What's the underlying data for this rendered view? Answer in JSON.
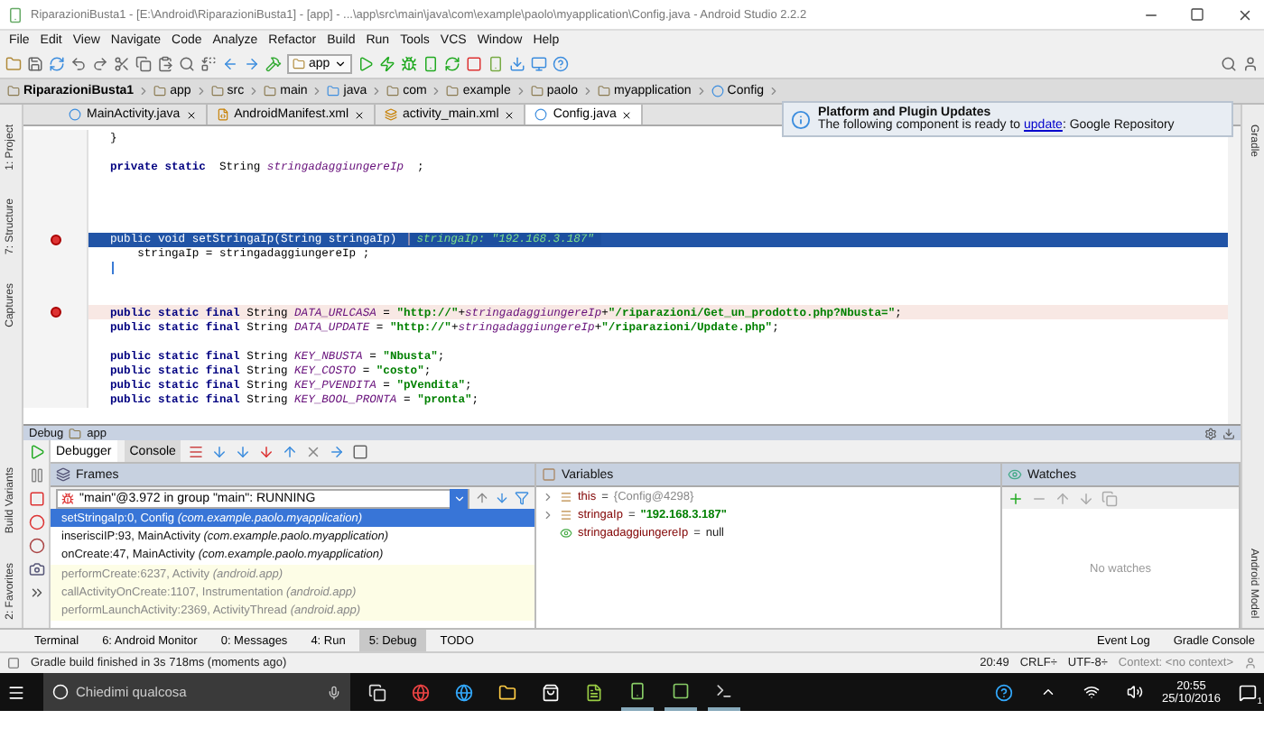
{
  "window": {
    "title": "RiparazioniBusta1 - [E:\\Android\\RiparazioniBusta1] - [app] - ...\\app\\src\\main\\java\\com\\example\\paolo\\myapplication\\Config.java - Android Studio 2.2.2"
  },
  "menu": [
    "File",
    "Edit",
    "View",
    "Navigate",
    "Code",
    "Analyze",
    "Refactor",
    "Build",
    "Run",
    "Tools",
    "VCS",
    "Window",
    "Help"
  ],
  "toolbar": {
    "run_config": "app"
  },
  "breadcrumb": [
    {
      "label": "RiparazioniBusta1",
      "kind": "project"
    },
    {
      "label": "app",
      "kind": "module"
    },
    {
      "label": "src",
      "kind": "folder"
    },
    {
      "label": "main",
      "kind": "folder"
    },
    {
      "label": "java",
      "kind": "source"
    },
    {
      "label": "com",
      "kind": "folder"
    },
    {
      "label": "example",
      "kind": "folder"
    },
    {
      "label": "paolo",
      "kind": "folder"
    },
    {
      "label": "myapplication",
      "kind": "folder"
    },
    {
      "label": "Config",
      "kind": "class"
    }
  ],
  "tabs": [
    {
      "label": "MainActivity.java",
      "kind": "class",
      "selected": false
    },
    {
      "label": "AndroidManifest.xml",
      "kind": "xml",
      "selected": false
    },
    {
      "label": "activity_main.xml",
      "kind": "layout",
      "selected": false
    },
    {
      "label": "Config.java",
      "kind": "class",
      "selected": true
    }
  ],
  "notification": {
    "title": "Platform and Plugin Updates",
    "text_before": "The following component is ready to ",
    "link": "update",
    "text_after": ": Google Repository"
  },
  "left_tools_top": [
    "1: Project",
    "7: Structure",
    "Captures"
  ],
  "left_tools_bottom": [
    "Build Variants",
    "2: Favorites"
  ],
  "right_tools_top": [
    "Gradle"
  ],
  "right_tools_bottom": [
    "Android Model"
  ],
  "editor": {
    "lines": [
      {
        "kind": "code",
        "breakpoint": false,
        "segments": [
          {
            "kind": "text",
            "t": "}"
          }
        ]
      },
      {
        "kind": "blank",
        "breakpoint": false
      },
      {
        "kind": "code",
        "breakpoint": false,
        "segments": [
          {
            "kind": "keyword",
            "t": "private static  "
          },
          {
            "kind": "text",
            "t": "String "
          },
          {
            "kind": "identifier",
            "t": "stringadaggiungereIp"
          },
          {
            "kind": "text",
            "t": "  ;"
          }
        ]
      },
      {
        "kind": "blank",
        "breakpoint": false
      },
      {
        "kind": "blank",
        "breakpoint": false
      },
      {
        "kind": "blank",
        "breakpoint": false
      },
      {
        "kind": "blank",
        "breakpoint": false
      },
      {
        "kind": "current",
        "breakpoint": true,
        "segments": [
          {
            "kind": "text",
            "t": "public void setStringaIp(String stringaIp)"
          }
        ],
        "inline_value": "stringaIp: \"192.168.3.187\""
      },
      {
        "kind": "code",
        "breakpoint": false,
        "segments": [
          {
            "kind": "text",
            "t": "    stringaIp = stringadaggiungereIp ;"
          }
        ]
      },
      {
        "kind": "cursor",
        "breakpoint": false
      },
      {
        "kind": "blank",
        "breakpoint": false
      },
      {
        "kind": "blank",
        "breakpoint": false
      },
      {
        "kind": "code",
        "breakpoint": true,
        "segments": [
          {
            "kind": "keyword",
            "t": "public static final "
          },
          {
            "kind": "text",
            "t": "String "
          },
          {
            "kind": "identifier",
            "t": "DATA_URLCASA"
          },
          {
            "kind": "text",
            "t": " = "
          },
          {
            "kind": "literal",
            "t": "\"http://\""
          },
          {
            "kind": "text",
            "t": "+"
          },
          {
            "kind": "identifier",
            "t": "stringadaggiungereIp"
          },
          {
            "kind": "text",
            "t": "+"
          },
          {
            "kind": "literal",
            "t": "\"/riparazioni/Get_un_prodotto.php?Nbusta=\""
          },
          {
            "kind": "text",
            "t": ";"
          }
        ]
      },
      {
        "kind": "code",
        "breakpoint": false,
        "segments": [
          {
            "kind": "keyword",
            "t": "public static final "
          },
          {
            "kind": "text",
            "t": "String "
          },
          {
            "kind": "identifier",
            "t": "DATA_UPDATE"
          },
          {
            "kind": "text",
            "t": " = "
          },
          {
            "kind": "literal",
            "t": "\"http://\""
          },
          {
            "kind": "text",
            "t": "+"
          },
          {
            "kind": "identifier",
            "t": "stringadaggiungereIp"
          },
          {
            "kind": "text",
            "t": "+"
          },
          {
            "kind": "literal",
            "t": "\"/riparazioni/Update.php\""
          },
          {
            "kind": "text",
            "t": ";"
          }
        ]
      },
      {
        "kind": "blank",
        "breakpoint": false
      },
      {
        "kind": "code",
        "breakpoint": false,
        "segments": [
          {
            "kind": "keyword",
            "t": "public static final "
          },
          {
            "kind": "text",
            "t": "String "
          },
          {
            "kind": "identifier",
            "t": "KEY_NBUSTA"
          },
          {
            "kind": "text",
            "t": " = "
          },
          {
            "kind": "literal",
            "t": "\"Nbusta\""
          },
          {
            "kind": "text",
            "t": ";"
          }
        ]
      },
      {
        "kind": "code",
        "breakpoint": false,
        "segments": [
          {
            "kind": "keyword",
            "t": "public static final "
          },
          {
            "kind": "text",
            "t": "String "
          },
          {
            "kind": "identifier",
            "t": "KEY_COSTO"
          },
          {
            "kind": "text",
            "t": " = "
          },
          {
            "kind": "literal",
            "t": "\"costo\""
          },
          {
            "kind": "text",
            "t": ";"
          }
        ]
      },
      {
        "kind": "code",
        "breakpoint": false,
        "segments": [
          {
            "kind": "keyword",
            "t": "public static final "
          },
          {
            "kind": "text",
            "t": "String "
          },
          {
            "kind": "identifier",
            "t": "KEY_PVENDITA"
          },
          {
            "kind": "text",
            "t": " = "
          },
          {
            "kind": "literal",
            "t": "\"pVendita\""
          },
          {
            "kind": "text",
            "t": ";"
          }
        ]
      },
      {
        "kind": "code",
        "breakpoint": false,
        "segments": [
          {
            "kind": "keyword",
            "t": "public static final "
          },
          {
            "kind": "text",
            "t": "String "
          },
          {
            "kind": "identifier",
            "t": "KEY_BOOL_PRONTA"
          },
          {
            "kind": "text",
            "t": " = "
          },
          {
            "kind": "literal",
            "t": "\"pronta\""
          },
          {
            "kind": "text",
            "t": ";"
          }
        ]
      }
    ]
  },
  "debug": {
    "title": "Debug",
    "config": "app",
    "tabs": [
      {
        "label": "Debugger",
        "selected": true
      },
      {
        "label": "Console",
        "selected": false
      }
    ],
    "frames": {
      "title": "Frames",
      "thread": "\"main\"@3.972 in group \"main\": RUNNING",
      "items": [
        {
          "method": "setStringaIp:0, Config",
          "package": "(com.example.paolo.myapplication)",
          "library": false,
          "selected": true
        },
        {
          "method": "inserisciIP:93, MainActivity",
          "package": "(com.example.paolo.myapplication)",
          "library": false,
          "selected": false
        },
        {
          "method": "onCreate:47, MainActivity",
          "package": "(com.example.paolo.myapplication)",
          "library": false,
          "selected": false
        },
        {
          "method": "performCreate:6237, Activity",
          "package": "(android.app)",
          "library": true,
          "selected": false
        },
        {
          "method": "callActivityOnCreate:1107, Instrumentation",
          "package": "(android.app)",
          "library": true,
          "selected": false
        },
        {
          "method": "performLaunchActivity:2369, ActivityThread",
          "package": "(android.app)",
          "library": true,
          "selected": false
        }
      ]
    },
    "variables": {
      "title": "Variables",
      "items": [
        {
          "name": "this",
          "operator": "=",
          "value": "{Config@4298}",
          "kind": "object",
          "expandable": true
        },
        {
          "name": "stringaIp",
          "operator": "=",
          "value": "\"192.168.3.187\"",
          "kind": "string",
          "expandable": true
        },
        {
          "name": "stringadaggiungereIp",
          "operator": "=",
          "value": "null",
          "kind": "static",
          "expandable": false
        }
      ]
    },
    "watches": {
      "title": "Watches",
      "empty": "No watches"
    }
  },
  "bottom_tabs": [
    {
      "label": "Terminal",
      "selected": false
    },
    {
      "label": "6: Android Monitor",
      "selected": false
    },
    {
      "label": "0: Messages",
      "selected": false
    },
    {
      "label": "4: Run",
      "selected": false
    },
    {
      "label": "5: Debug",
      "selected": true
    },
    {
      "label": "TODO",
      "selected": false
    }
  ],
  "bottom_right_tabs": [
    "Event Log",
    "Gradle Console"
  ],
  "status_bar": {
    "message": "Gradle build finished in 3s 718ms (moments ago)",
    "position": "20:49",
    "line_ending": "CRLF÷",
    "encoding": "UTF-8÷",
    "context": "Context: <no context>"
  },
  "taskbar": {
    "search": "Chiedimi qualcosa",
    "time": "20:55",
    "date": "25/10/2016",
    "notifications": "1"
  }
}
